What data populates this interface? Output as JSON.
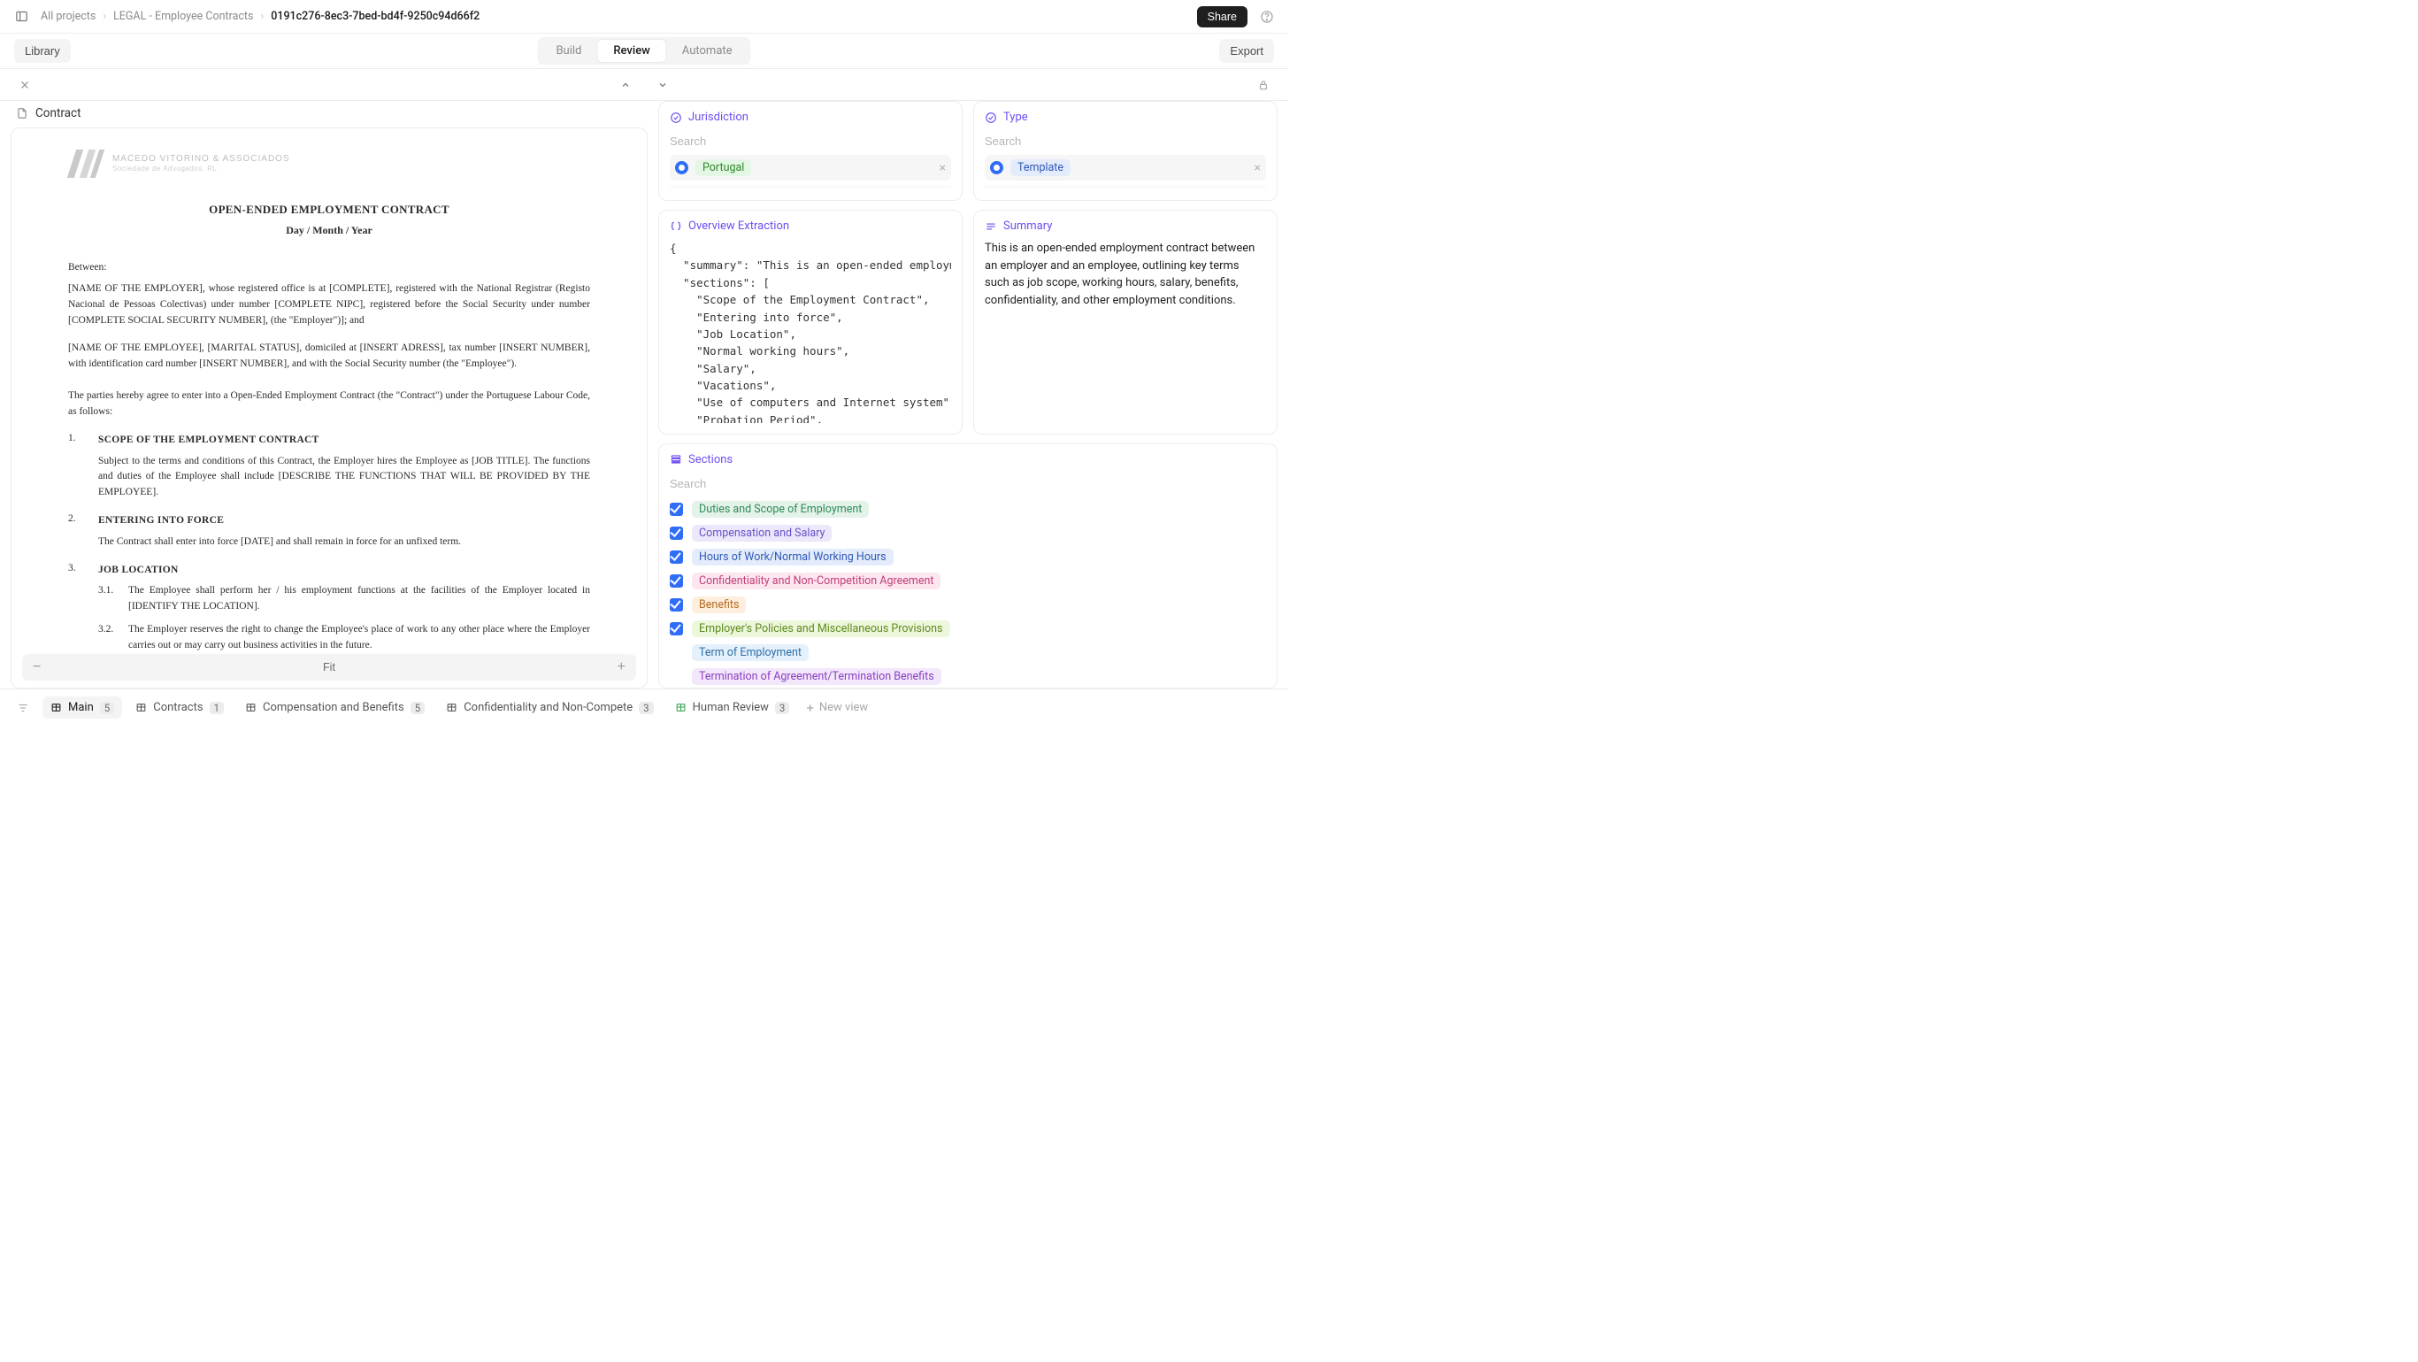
{
  "breadcrumbs": {
    "root": "All projects",
    "project": "LEGAL - Employee Contracts",
    "item": "0191c276-8ec3-7bed-bd4f-9250c94d66f2"
  },
  "topbar": {
    "share": "Share"
  },
  "tabs": {
    "library": "Library",
    "build": "Build",
    "review": "Review",
    "automate": "Automate",
    "export": "Export"
  },
  "doc": {
    "tab_title": "Contract",
    "firm_name": "MACEDO VITORINO & ASSOCIADOS",
    "firm_sub": "Sociedade de Advogados, RL",
    "title": "OPEN-ENDED EMPLOYMENT CONTRACT",
    "date": "Day / Month / Year",
    "between": "Between:",
    "p1": "[NAME OF THE EMPLOYER], whose registered office is at [COMPLETE], registered with the National Registrar (Registo Nacional de Pessoas Colectivas) under number [COMPLETE NIPC], registered before the Social Security under number [COMPLETE SOCIAL SECURITY NUMBER], (the \"Employer\")]; and",
    "p2": "[NAME OF THE EMPLOYEE], [MARITAL STATUS], domiciled at [INSERT ADRESS], tax number [INSERT NUMBER], with identification card number [INSERT NUMBER], and with the Social Security number (the \"Employee\").",
    "intro": "The parties hereby agree to enter into a Open-Ended Employment Contract (the \"Contract\") under the Portuguese Labour Code, as follows:",
    "s1_head": "SCOPE OF THE EMPLOYMENT CONTRACT",
    "s1_body": "Subject to the terms and conditions of this Contract, the Employer hires the Employee as [JOB TITLE]. The functions and duties of the Employee shall include [DESCRIBE THE FUNCTIONS THAT WILL BE PROVIDED BY THE EMPLOYEE].",
    "s2_head": "ENTERING INTO FORCE",
    "s2_body": "The Contract shall enter into force [DATE] and shall remain in force for an unfixed term.",
    "s3_head": "JOB LOCATION",
    "s3_1": "The Employee shall perform her / his employment functions at the facilities of the Employer located in [IDENTIFY THE LOCATION].",
    "s3_2": "The Employer reserves the right to change the Employee's place of work to any other place where the Employer carries out or may carry out business activities in the future.",
    "zoom_label": "Fit"
  },
  "jurisdiction": {
    "title": "Jurisdiction",
    "search_ph": "Search",
    "value": "Portugal"
  },
  "type": {
    "title": "Type",
    "search_ph": "Search",
    "value": "Template"
  },
  "overview": {
    "title": "Overview Extraction",
    "json": "{\n  \"summary\": \"This is an open-ended employment contract between an employer and an employee, outlining key terms such as job scope, working hours, salary, benefits, confidentiality, and other employment conditions.\",\n  \"sections\": [\n    \"Scope of the Employment Contract\",\n    \"Entering into force\",\n    \"Job Location\",\n    \"Normal working hours\",\n    \"Salary\",\n    \"Vacations\",\n    \"Use of computers and Internet system\",\n    \"Probation Period\",\n    \"Exclusivity\",\n    \"Confidentiality\","
  },
  "summary": {
    "title": "Summary",
    "text": "This is an open-ended employment contract between an employer and an employee, outlining key terms such as job scope, working hours, salary, benefits, confidentiality, and other employment conditions."
  },
  "sections": {
    "title": "Sections",
    "search_ph": "Search",
    "items": [
      {
        "label": "Duties and Scope of Employment",
        "checked": true,
        "cls": "c1"
      },
      {
        "label": "Compensation and Salary",
        "checked": true,
        "cls": "c2"
      },
      {
        "label": "Hours of Work/Normal Working Hours",
        "checked": true,
        "cls": "c3"
      },
      {
        "label": "Confidentiality and Non-Competition Agreement",
        "checked": true,
        "cls": "c4"
      },
      {
        "label": "Benefits",
        "checked": true,
        "cls": "c5"
      },
      {
        "label": "Employer's Policies and Miscellaneous Provisions",
        "checked": true,
        "cls": "c6"
      },
      {
        "label": "Term of Employment",
        "checked": false,
        "cls": "c7"
      },
      {
        "label": "Termination of Agreement/Termination Benefits",
        "checked": false,
        "cls": "c8"
      }
    ]
  },
  "views": {
    "new": "New view",
    "items": [
      {
        "label": "Main",
        "count": "5",
        "active": true,
        "color": ""
      },
      {
        "label": "Contracts",
        "count": "1",
        "active": false,
        "color": ""
      },
      {
        "label": "Compensation and Benefits",
        "count": "5",
        "active": false,
        "color": ""
      },
      {
        "label": "Confidentiality and Non-Compete",
        "count": "3",
        "active": false,
        "color": ""
      },
      {
        "label": "Human Review",
        "count": "3",
        "active": false,
        "color": "green"
      }
    ]
  }
}
